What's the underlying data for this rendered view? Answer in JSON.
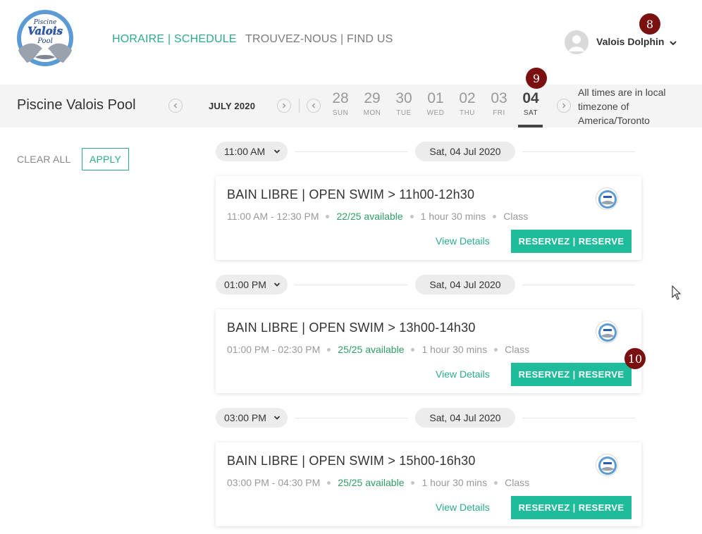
{
  "header": {
    "logo": {
      "line1": "Piscine",
      "line2": "Valois",
      "line3": "Pool"
    },
    "nav": {
      "schedule": "HORAIRE | SCHEDULE",
      "find_us": "TROUVEZ-NOUS | FIND US"
    },
    "user": {
      "name": "Valois Dolphin",
      "icon": "user-avatar-icon"
    }
  },
  "markers": {
    "m8": "8",
    "m9": "9",
    "m10": "10"
  },
  "datebar": {
    "pool_title": "Piscine Valois Pool",
    "month": "JULY 2020",
    "days": [
      {
        "num": "28",
        "dow": "SUN"
      },
      {
        "num": "29",
        "dow": "MON"
      },
      {
        "num": "30",
        "dow": "TUE"
      },
      {
        "num": "01",
        "dow": "WED"
      },
      {
        "num": "02",
        "dow": "THU"
      },
      {
        "num": "03",
        "dow": "FRI"
      },
      {
        "num": "04",
        "dow": "SAT"
      }
    ],
    "selected_day": "04",
    "tz_note": "All times are in local timezone of America/Toronto"
  },
  "filters": {
    "clear_all": "CLEAR ALL",
    "apply": "APPLY"
  },
  "slots": [
    {
      "time": "11:00 AM",
      "date": "Sat, 04 Jul 2020",
      "title": "BAIN LIBRE | OPEN SWIM > 11h00-12h30",
      "range": "11:00 AM - 12:30 PM",
      "availability": "22/25 available",
      "duration": "1 hour 30 mins",
      "kind": "Class",
      "view_details": "View Details",
      "reserve": "RESERVEZ | RESERVE"
    },
    {
      "time": "01:00 PM",
      "date": "Sat, 04 Jul 2020",
      "title": "BAIN LIBRE | OPEN SWIM > 13h00-14h30",
      "range": "01:00 PM - 02:30 PM",
      "availability": "25/25 available",
      "duration": "1 hour 30 mins",
      "kind": "Class",
      "view_details": "View Details",
      "reserve": "RESERVEZ | RESERVE"
    },
    {
      "time": "03:00 PM",
      "date": "Sat, 04 Jul 2020",
      "title": "BAIN LIBRE | OPEN SWIM > 15h00-16h30",
      "range": "03:00 PM - 04:30 PM",
      "availability": "25/25 available",
      "duration": "1 hour 30 mins",
      "kind": "Class",
      "view_details": "View Details",
      "reserve": "RESERVEZ | RESERVE"
    }
  ],
  "colors": {
    "accent": "#2bab8c",
    "reserve_button": "#1fbc9c",
    "available_text": "#2e9e66",
    "marker": "#7a1010",
    "datebar_bg": "#f4f4f4"
  }
}
